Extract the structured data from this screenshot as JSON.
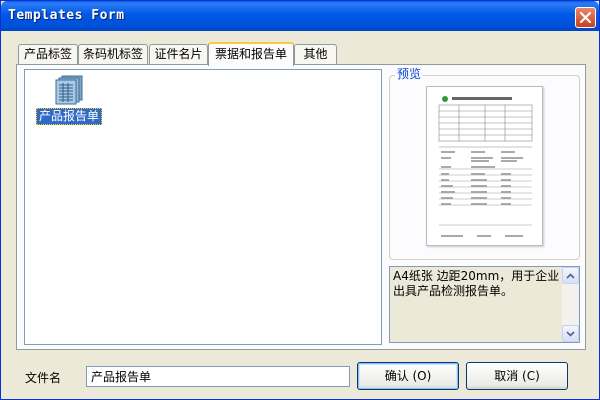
{
  "window": {
    "title": "Templates Form"
  },
  "tabs": [
    {
      "label": "产品标签",
      "active": false
    },
    {
      "label": "条码机标签",
      "active": false
    },
    {
      "label": "证件名片",
      "active": false
    },
    {
      "label": "票据和报告单",
      "active": true
    },
    {
      "label": "其他",
      "active": false
    }
  ],
  "list": {
    "items": [
      {
        "label": "产品报告单",
        "icon": "document-stack-icon",
        "selected": true
      }
    ]
  },
  "preview": {
    "legend": "预览",
    "description": "A4纸张 边距20mm，用于企业出具产品检测报告单。"
  },
  "form": {
    "file_label": "文件名",
    "file_value": "产品报告单",
    "ok_label": "确认 (O)",
    "cancel_label": "取消 (C)"
  },
  "colors": {
    "titlebar": "#0058E6",
    "selection": "#316AC5",
    "active_tab_accent": "#FFC83C",
    "legend_text": "#0046D5"
  }
}
